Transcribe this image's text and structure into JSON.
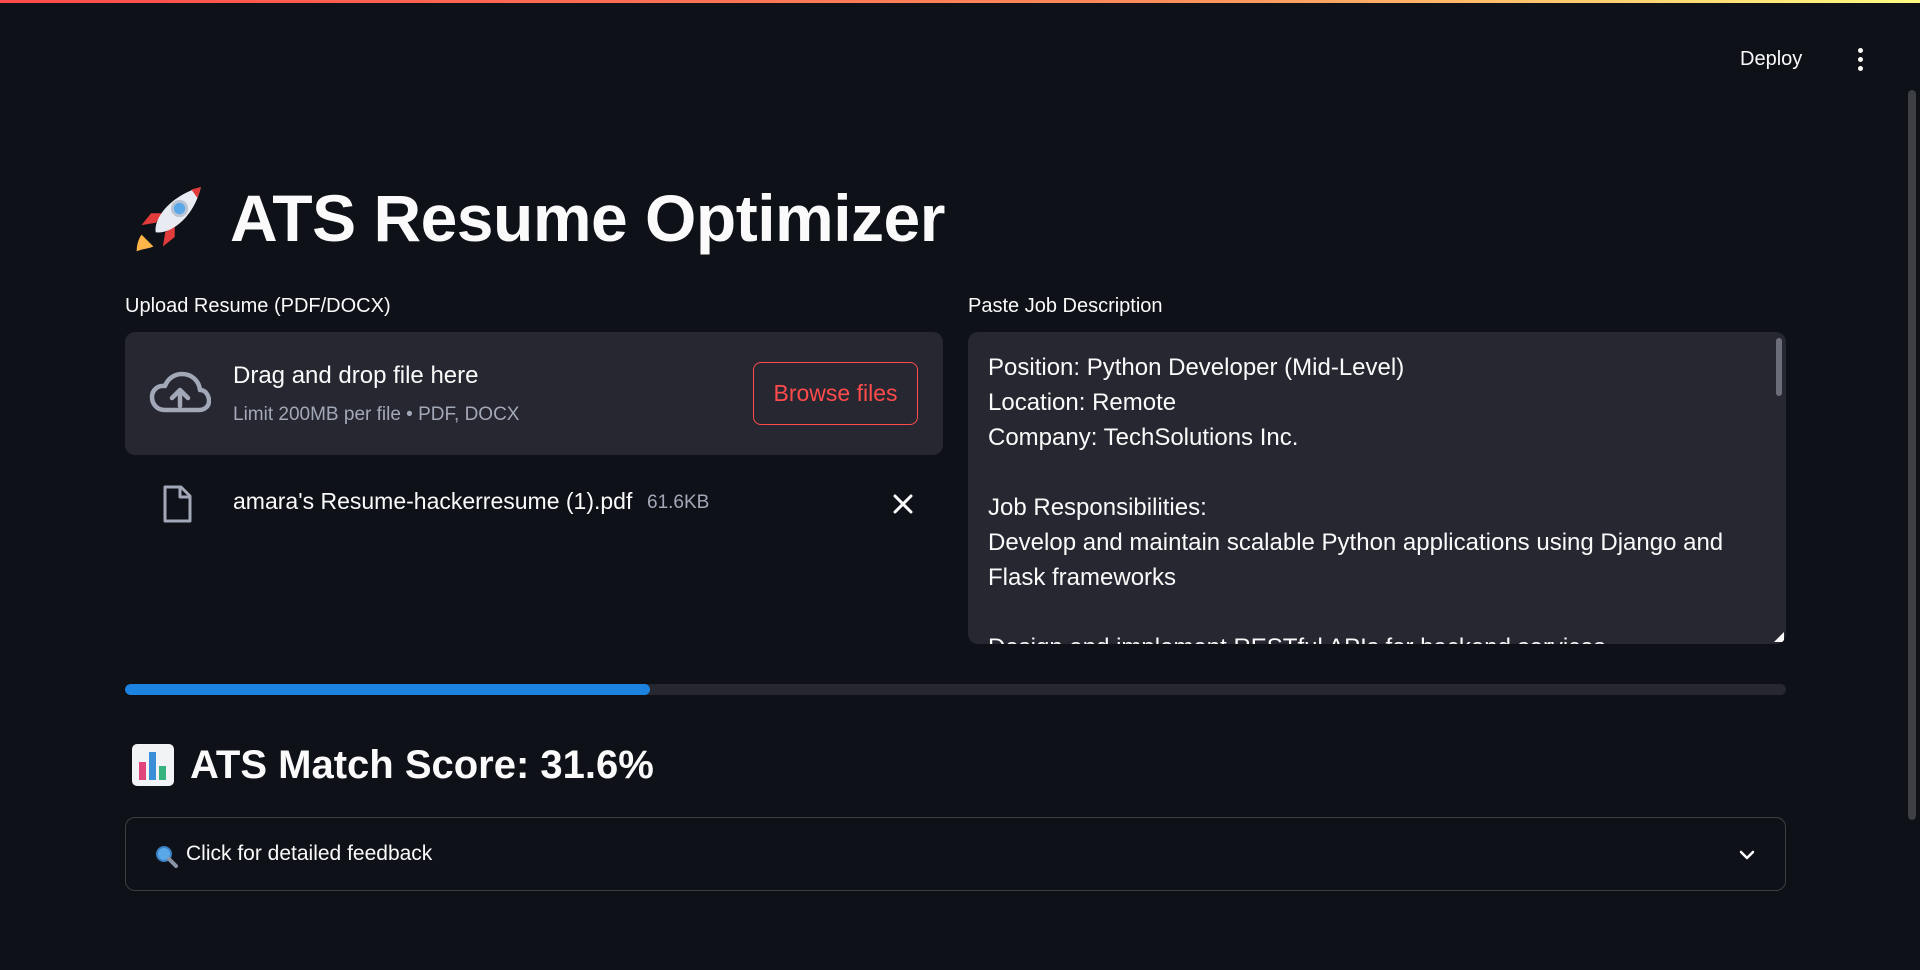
{
  "header": {
    "deploy_label": "Deploy",
    "menu_icon": "more-vertical-icon"
  },
  "title": {
    "icon": "rocket-icon",
    "text": "ATS Resume Optimizer"
  },
  "upload": {
    "label": "Upload Resume (PDF/DOCX)",
    "drop_text": "Drag and drop file here",
    "limit_text": "Limit 200MB per file • PDF, DOCX",
    "browse_label": "Browse files",
    "file": {
      "name": "amara's Resume-hackerresume (1).pdf",
      "size": "61.6KB"
    }
  },
  "job_description": {
    "label": "Paste Job Description",
    "text": "Position: Python Developer (Mid-Level)\nLocation: Remote\nCompany: TechSolutions Inc.\n\nJob Responsibilities:\nDevelop and maintain scalable Python applications using Django and Flask frameworks\n\nDesign and implement RESTful APIs for backend services"
  },
  "progress": {
    "value": 0.316
  },
  "score": {
    "icon": "bar-chart-icon",
    "text": "ATS Match Score: 31.6%"
  },
  "feedback": {
    "icon": "magnifier-icon",
    "label": "Click for detailed feedback"
  },
  "colors": {
    "background": "#0e1117",
    "surface": "#262730",
    "accent_red": "#ff4b4b",
    "progress_blue": "#1c83e1",
    "muted_text": "#a3a8b8"
  }
}
